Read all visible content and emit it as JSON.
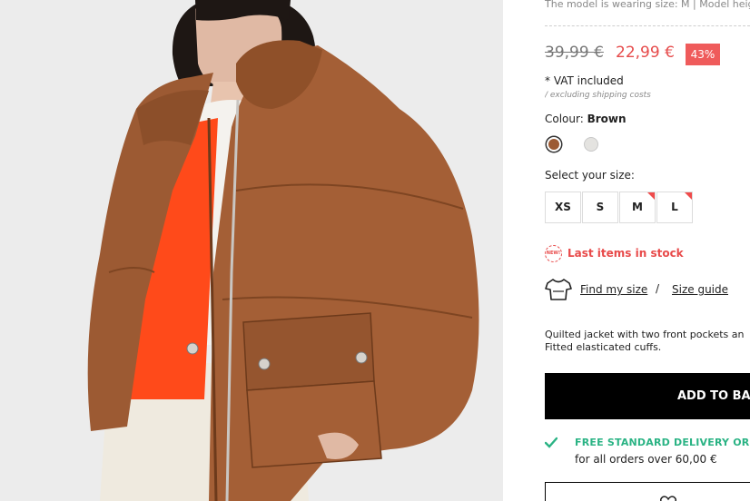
{
  "product": {
    "model_note": "The model is wearing size: M | Model height",
    "old_price": "39,99 €",
    "new_price": "22,99 €",
    "discount": "43%",
    "vat": "* VAT included",
    "shipping": "/ excluding shipping costs",
    "colour_label": "Colour:",
    "colour_value": "Brown",
    "colours": [
      {
        "name": "Brown",
        "hex": "#9c5a33"
      },
      {
        "name": "Ecru",
        "hex": "#e4e3e0"
      }
    ],
    "size_label": "Select your size:",
    "sizes": [
      {
        "label": "XS",
        "low_stock": false
      },
      {
        "label": "S",
        "low_stock": false
      },
      {
        "label": "M",
        "low_stock": true
      },
      {
        "label": "L",
        "low_stock": true
      }
    ],
    "new_badge": "NEW!",
    "last_items": "Last items in stock",
    "find_size": "Find my size",
    "separator": "/",
    "size_guide": "Size guide",
    "description_line1": "Quilted jacket with two front pockets an",
    "description_line2": "Fitted elasticated cuffs.",
    "add_button": "ADD TO BAS",
    "delivery_title": "FREE STANDARD DELIVERY OR DE",
    "delivery_sub": "for all orders over 60,00 €"
  },
  "colors": {
    "accent_red": "#e64b4b",
    "delivery_green": "#2ab384",
    "jacket_brown": "#9c5a33",
    "lining_orange": "#ff4a1a"
  },
  "icons": [
    "tshirt-icon",
    "check-icon",
    "heart-icon",
    "new-badge-icon"
  ]
}
